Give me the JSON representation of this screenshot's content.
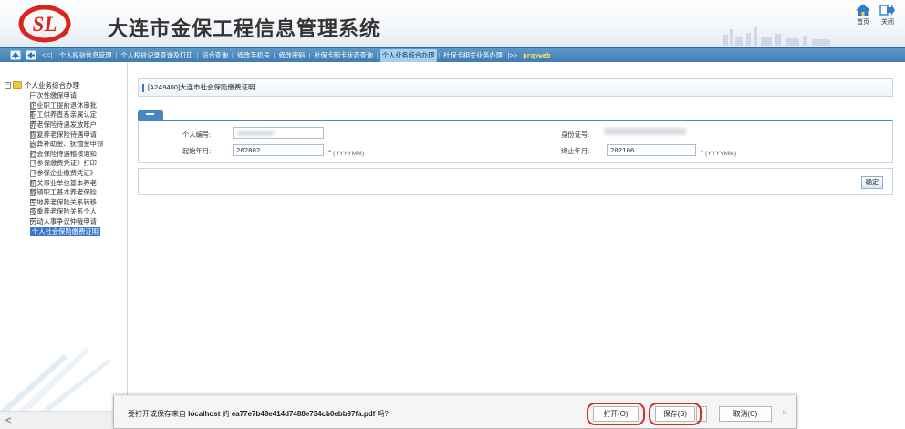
{
  "header": {
    "logo_text": "SL",
    "title": "大连市金保工程信息管理系统",
    "home_label": "首页",
    "close_label": "关闭"
  },
  "navbar": {
    "lt": "<<|",
    "tabs": [
      {
        "label": "个人权益信息管理"
      },
      {
        "label": "个人权益记录查询及打印"
      },
      {
        "label": "综合查询"
      },
      {
        "label": "修改手机号"
      },
      {
        "label": "修改密码"
      },
      {
        "label": "社保卡制卡状态查询"
      },
      {
        "label": "个人业务综合办理"
      },
      {
        "label": "社保卡相关业务办理"
      }
    ],
    "more": "|>>",
    "user": "grqyweb",
    "dots": "· · ·"
  },
  "sidebar": {
    "root": "个人业务综合办理",
    "items": [
      "一次性缴保申请",
      "企业职工提前退休审批",
      "职工供养直系亲属认定",
      "养老保险待遇发放账户",
      "恢复养老保险待遇申请",
      "丧葬补助金、抚恤金申领",
      "社会保险待遇稽核通知",
      "《参保缴费凭证》打印",
      "《参保企业缴费凭证》",
      "机关事业单位基本养老",
      "城镇职工基本养老保险",
      "军地养老保险关系转移",
      "多重养老保险关系个人",
      "劳动人事争议仲裁申请",
      "个人社会保险缴费证明"
    ],
    "selected_index": 14,
    "scroll_left": "<"
  },
  "main": {
    "panel_title": "[A2A9400]大连市社会保险缴费证明",
    "form": {
      "person_no_label": "个人编号:",
      "id_label": "身份证号:",
      "start_label": "起始年月:",
      "start_value": "202002",
      "end_label": "终止年月:",
      "end_value": "202106",
      "format_hint": "(YYYYMM)",
      "required_mark": "*"
    },
    "confirm_label": "确定"
  },
  "download_bar": {
    "msg_prefix": "要打开或保存来自 ",
    "host": "localhost",
    "msg_mid": " 的 ",
    "filename": "ea77e7b48e414d7488e734cb0ebb97fa.pdf",
    "msg_suffix": " 吗?",
    "open_label": "打开(O)",
    "save_label": "保存(S)",
    "dropdown_glyph": "▼",
    "cancel_label": "取消(C)",
    "close_glyph": "×"
  },
  "colors": {
    "nav_blue": "#4a86c1",
    "active_tab": "#a9cfee",
    "annotation_red": "#d62b2b",
    "selected_item": "#3b77c9"
  }
}
